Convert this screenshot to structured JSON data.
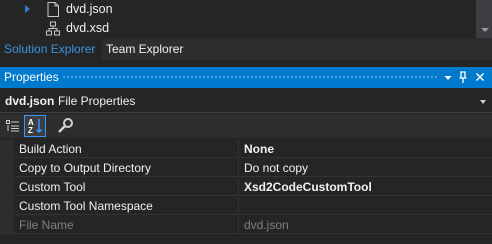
{
  "solution_tree": {
    "items": [
      {
        "label": "dvd.json",
        "icon": "json-file-icon",
        "expandable": true
      },
      {
        "label": "dvd.xsd",
        "icon": "xsd-schema-icon",
        "expandable": false
      }
    ]
  },
  "tool_tabs": [
    {
      "label": "Solution Explorer",
      "active": true
    },
    {
      "label": "Team Explorer",
      "active": false
    }
  ],
  "properties_window": {
    "title": "Properties",
    "title_buttons": [
      "dropdown-menu-icon",
      "pin-icon",
      "close-icon"
    ],
    "selector": {
      "object_name": "dvd.json",
      "object_type": "File Properties"
    },
    "toolbar": [
      "categorized-view-icon",
      "alphabetical-view-icon",
      "property-pages-icon"
    ],
    "rows": [
      {
        "name": "Build Action",
        "value": "None",
        "bold": true,
        "readonly": false
      },
      {
        "name": "Copy to Output Directory",
        "value": "Do not copy",
        "bold": false,
        "readonly": false
      },
      {
        "name": "Custom Tool",
        "value": "Xsd2CodeCustomTool",
        "bold": true,
        "readonly": false
      },
      {
        "name": "Custom Tool Namespace",
        "value": "",
        "bold": false,
        "readonly": false
      },
      {
        "name": "File Name",
        "value": "dvd.json",
        "bold": false,
        "readonly": true
      }
    ]
  },
  "colors": {
    "background": "#252526",
    "title_bar_active": "#007acc",
    "active_tab_text": "#3794e0",
    "expander": "#2f7fc9"
  }
}
